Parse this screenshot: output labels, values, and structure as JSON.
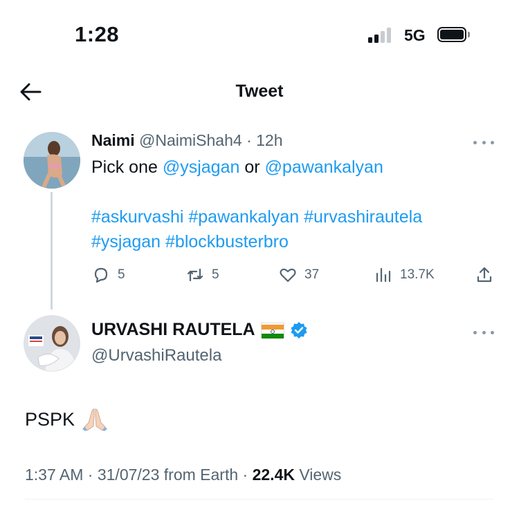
{
  "status_bar": {
    "time": "1:28",
    "network": "5G",
    "signal_icon": "cellular-signal-icon",
    "battery_icon": "battery-icon"
  },
  "nav": {
    "title": "Tweet",
    "back_icon": "back-arrow-icon"
  },
  "reply_tweet": {
    "name": "Naimi",
    "handle": "@NaimiShah4",
    "separator": "·",
    "time_ago": "12h",
    "text_prefix": "Pick one ",
    "mention1": "@ysjagan",
    "text_mid": " or ",
    "mention2": "@pawankalyan",
    "hashtags_line1": [
      "#askurvashi",
      "#pawankalyan",
      "#urvashirautela"
    ],
    "hashtags_line2": [
      "#ysjagan",
      "#blockbusterbro"
    ],
    "actions": {
      "replies": "5",
      "retweets": "5",
      "likes": "37",
      "views": "13.7K"
    }
  },
  "main_tweet": {
    "name": "URVASHI RAUTELA",
    "handle": "@UrvashiRautela",
    "text": "PSPK",
    "emoji": "folded-hands-emoji",
    "time": "1:37 AM",
    "date": "31/07/23",
    "source": "from Earth",
    "views_count": "22.4K",
    "views_label": "Views"
  },
  "colors": {
    "link": "#1d9bf0",
    "secondary_text": "#536471",
    "primary_text": "#0f1419",
    "verified": "#1d9bf0"
  }
}
